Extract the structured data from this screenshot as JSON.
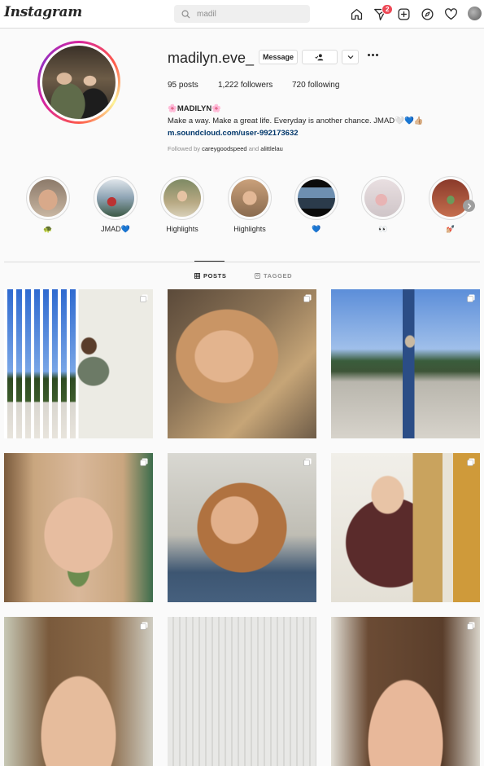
{
  "nav": {
    "logo": "Instagram",
    "search_value": "madil",
    "messages_badge": "2",
    "icons": [
      "home-icon",
      "direct-icon",
      "new-post-icon",
      "explore-icon",
      "activity-heart-icon",
      "profile-avatar"
    ]
  },
  "profile": {
    "username": "madilyn.eve_",
    "message_label": "Message",
    "stats": {
      "posts_count": "95",
      "posts_label": "posts",
      "followers_count": "1,222",
      "followers_label": "followers",
      "following_count": "720",
      "following_label": "following"
    },
    "bio": {
      "name": "🌸MADILYN🌸",
      "line": "Make a way. Make a great life. Everyday is another chance. JMAD🤍💙👍🏼",
      "link": "m.soundcloud.com/user-992173632"
    },
    "followed_by": {
      "prefix": "Followed by",
      "user1": "careygoodspeed",
      "and": "and",
      "user2": "alittlelau"
    }
  },
  "highlights": [
    {
      "label": "🐢"
    },
    {
      "label": "JMAD💙"
    },
    {
      "label": "Highlights"
    },
    {
      "label": "Highlights"
    },
    {
      "label": "💙"
    },
    {
      "label": "👀"
    },
    {
      "label": "💅🏼"
    }
  ],
  "tabs": {
    "posts": "POSTS",
    "tagged": "TAGGED"
  },
  "colors": {
    "accent_link": "#00376b",
    "badge": "#ed4956",
    "border": "#dbdbdb",
    "text": "#262626",
    "muted": "#8e8e8e"
  }
}
